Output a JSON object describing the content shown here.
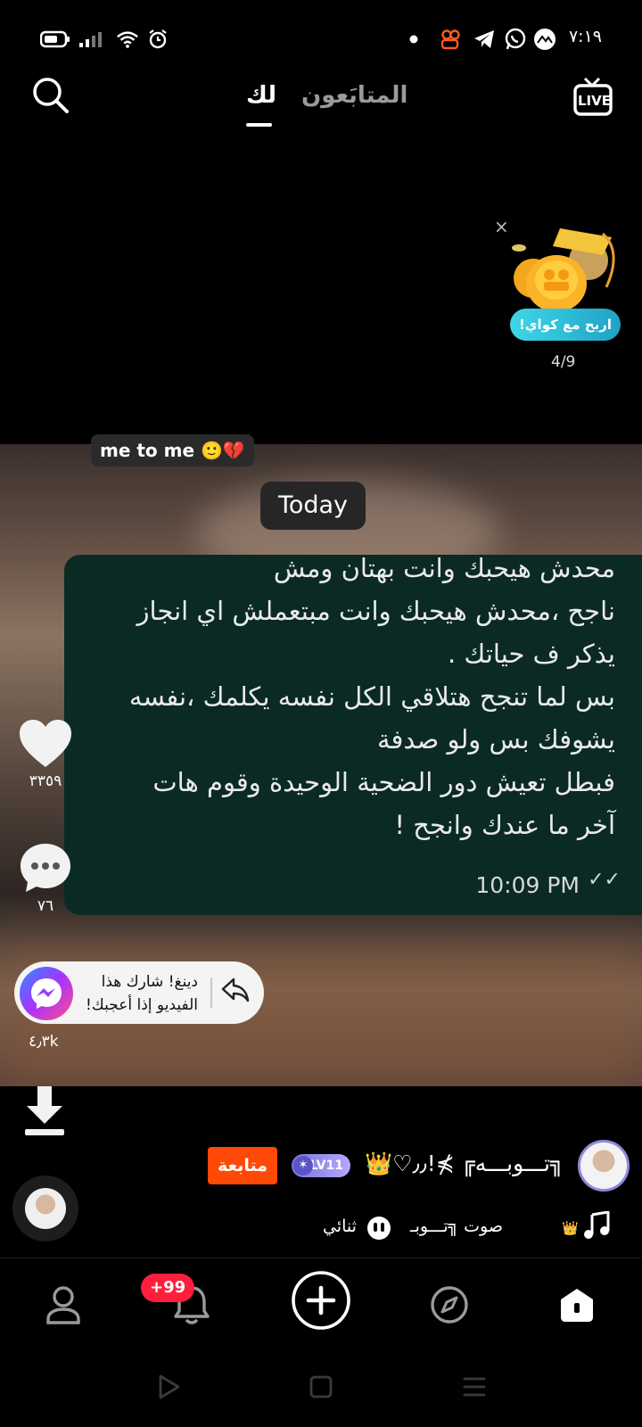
{
  "status_bar": {
    "time": "٧:١٩",
    "icons": [
      "battery-icon",
      "signal-icon",
      "wifi-icon",
      "alarm-icon",
      "dot-icon",
      "kwai-notif-icon",
      "telegram-icon",
      "whatsapp-icon",
      "app-notif-icon"
    ]
  },
  "top_nav": {
    "search_icon": "search-icon",
    "tab_following": "المتابَعون",
    "tab_for_you": "لك",
    "live_icon": "live-tv-icon",
    "live_label": "LIVE"
  },
  "promo": {
    "label": "اربح مع كواي!",
    "progress": "4/9",
    "close": "×"
  },
  "video": {
    "caption": "me to me 🙂💔",
    "date_pill": "Today",
    "message_lines": [
      "محدش هيحبك وانت بهتان ومش",
      "ناجح ،محدش هيحبك وانت مبتعملش اي انجاز",
      "يذكر ف حياتك .",
      "بس لما تنجح هتلاقي الكل نفسه يكلمك ،نفسه",
      "يشوفك بس ولو صدفة",
      "فبطل تعيش دور الضحية الوحيدة وقوم هات",
      "آخر ما عندك وانجح !"
    ],
    "message_time": "10:09 PM",
    "ticks": "✓✓"
  },
  "actions": {
    "likes": "٣٣٥٩",
    "comments": "٧٦",
    "shares": "٤٫٣k"
  },
  "share_tip": {
    "text": "دينغ! شارك هذا الفيديو إذا أعجبك!"
  },
  "author": {
    "name": "╗تـــوبـــه╔ ⋡!٫٫♡👑",
    "level": "LV11",
    "follow_label": "متابعة"
  },
  "music": {
    "sound_label": "صوت ╗تـــوبـ",
    "duet_label": "ثنائي"
  },
  "bottom_nav": {
    "notif_badge": "+99"
  }
}
